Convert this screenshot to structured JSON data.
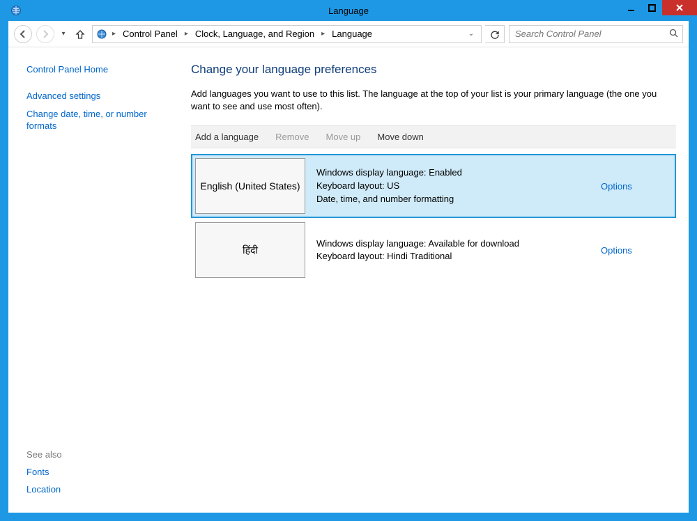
{
  "window": {
    "title": "Language"
  },
  "nav": {
    "breadcrumbs": {
      "seg1": "Control Panel",
      "seg2": "Clock, Language, and Region",
      "seg3": "Language"
    },
    "search_placeholder": "Search Control Panel"
  },
  "sidebar": {
    "home": "Control Panel Home",
    "links": {
      "advanced": "Advanced settings",
      "datefmt": "Change date, time, or number formats"
    },
    "see_also_hdr": "See also",
    "see_also": {
      "fonts": "Fonts",
      "location": "Location"
    }
  },
  "main": {
    "heading": "Change your language preferences",
    "description": "Add languages you want to use to this list. The language at the top of your list is your primary language (the one you want to see and use most often).",
    "toolbar": {
      "add": "Add a language",
      "remove": "Remove",
      "move_up": "Move up",
      "move_down": "Move down"
    },
    "languages": [
      {
        "tile": "English (United States)",
        "line1": "Windows display language: Enabled",
        "line2": "Keyboard layout: US",
        "line3": "Date, time, and number formatting",
        "options": "Options",
        "selected": true
      },
      {
        "tile": "हिंदी",
        "line1": "Windows display language: Available for download",
        "line2": "Keyboard layout: Hindi Traditional",
        "line3": "",
        "options": "Options",
        "selected": false
      }
    ]
  }
}
